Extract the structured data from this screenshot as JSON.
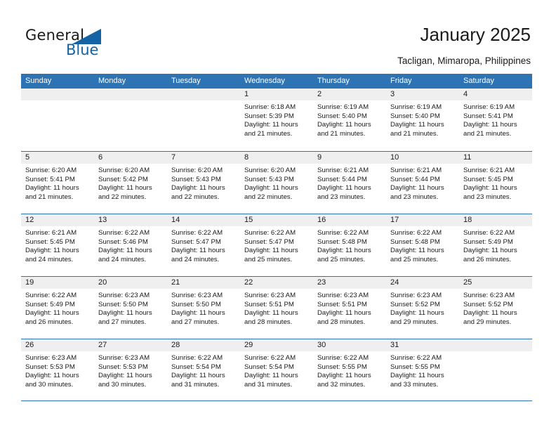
{
  "brand": {
    "name_part1": "General",
    "name_part2": "Blue",
    "accent_color": "#1464a5"
  },
  "header": {
    "title": "January 2025",
    "subtitle": "Tacligan, Mimaropa, Philippines",
    "header_bg_color": "#2e74b5",
    "daynum_bg_color": "#efefef"
  },
  "weekdays": [
    "Sunday",
    "Monday",
    "Tuesday",
    "Wednesday",
    "Thursday",
    "Friday",
    "Saturday"
  ],
  "weeks": [
    [
      {
        "day": "",
        "sunrise": "",
        "sunset": "",
        "daylight1": "",
        "daylight2": ""
      },
      {
        "day": "",
        "sunrise": "",
        "sunset": "",
        "daylight1": "",
        "daylight2": ""
      },
      {
        "day": "",
        "sunrise": "",
        "sunset": "",
        "daylight1": "",
        "daylight2": ""
      },
      {
        "day": "1",
        "sunrise": "Sunrise: 6:18 AM",
        "sunset": "Sunset: 5:39 PM",
        "daylight1": "Daylight: 11 hours",
        "daylight2": "and 21 minutes."
      },
      {
        "day": "2",
        "sunrise": "Sunrise: 6:19 AM",
        "sunset": "Sunset: 5:40 PM",
        "daylight1": "Daylight: 11 hours",
        "daylight2": "and 21 minutes."
      },
      {
        "day": "3",
        "sunrise": "Sunrise: 6:19 AM",
        "sunset": "Sunset: 5:40 PM",
        "daylight1": "Daylight: 11 hours",
        "daylight2": "and 21 minutes."
      },
      {
        "day": "4",
        "sunrise": "Sunrise: 6:19 AM",
        "sunset": "Sunset: 5:41 PM",
        "daylight1": "Daylight: 11 hours",
        "daylight2": "and 21 minutes."
      }
    ],
    [
      {
        "day": "5",
        "sunrise": "Sunrise: 6:20 AM",
        "sunset": "Sunset: 5:41 PM",
        "daylight1": "Daylight: 11 hours",
        "daylight2": "and 21 minutes."
      },
      {
        "day": "6",
        "sunrise": "Sunrise: 6:20 AM",
        "sunset": "Sunset: 5:42 PM",
        "daylight1": "Daylight: 11 hours",
        "daylight2": "and 22 minutes."
      },
      {
        "day": "7",
        "sunrise": "Sunrise: 6:20 AM",
        "sunset": "Sunset: 5:43 PM",
        "daylight1": "Daylight: 11 hours",
        "daylight2": "and 22 minutes."
      },
      {
        "day": "8",
        "sunrise": "Sunrise: 6:20 AM",
        "sunset": "Sunset: 5:43 PM",
        "daylight1": "Daylight: 11 hours",
        "daylight2": "and 22 minutes."
      },
      {
        "day": "9",
        "sunrise": "Sunrise: 6:21 AM",
        "sunset": "Sunset: 5:44 PM",
        "daylight1": "Daylight: 11 hours",
        "daylight2": "and 23 minutes."
      },
      {
        "day": "10",
        "sunrise": "Sunrise: 6:21 AM",
        "sunset": "Sunset: 5:44 PM",
        "daylight1": "Daylight: 11 hours",
        "daylight2": "and 23 minutes."
      },
      {
        "day": "11",
        "sunrise": "Sunrise: 6:21 AM",
        "sunset": "Sunset: 5:45 PM",
        "daylight1": "Daylight: 11 hours",
        "daylight2": "and 23 minutes."
      }
    ],
    [
      {
        "day": "12",
        "sunrise": "Sunrise: 6:21 AM",
        "sunset": "Sunset: 5:45 PM",
        "daylight1": "Daylight: 11 hours",
        "daylight2": "and 24 minutes."
      },
      {
        "day": "13",
        "sunrise": "Sunrise: 6:22 AM",
        "sunset": "Sunset: 5:46 PM",
        "daylight1": "Daylight: 11 hours",
        "daylight2": "and 24 minutes."
      },
      {
        "day": "14",
        "sunrise": "Sunrise: 6:22 AM",
        "sunset": "Sunset: 5:47 PM",
        "daylight1": "Daylight: 11 hours",
        "daylight2": "and 24 minutes."
      },
      {
        "day": "15",
        "sunrise": "Sunrise: 6:22 AM",
        "sunset": "Sunset: 5:47 PM",
        "daylight1": "Daylight: 11 hours",
        "daylight2": "and 25 minutes."
      },
      {
        "day": "16",
        "sunrise": "Sunrise: 6:22 AM",
        "sunset": "Sunset: 5:48 PM",
        "daylight1": "Daylight: 11 hours",
        "daylight2": "and 25 minutes."
      },
      {
        "day": "17",
        "sunrise": "Sunrise: 6:22 AM",
        "sunset": "Sunset: 5:48 PM",
        "daylight1": "Daylight: 11 hours",
        "daylight2": "and 25 minutes."
      },
      {
        "day": "18",
        "sunrise": "Sunrise: 6:22 AM",
        "sunset": "Sunset: 5:49 PM",
        "daylight1": "Daylight: 11 hours",
        "daylight2": "and 26 minutes."
      }
    ],
    [
      {
        "day": "19",
        "sunrise": "Sunrise: 6:22 AM",
        "sunset": "Sunset: 5:49 PM",
        "daylight1": "Daylight: 11 hours",
        "daylight2": "and 26 minutes."
      },
      {
        "day": "20",
        "sunrise": "Sunrise: 6:23 AM",
        "sunset": "Sunset: 5:50 PM",
        "daylight1": "Daylight: 11 hours",
        "daylight2": "and 27 minutes."
      },
      {
        "day": "21",
        "sunrise": "Sunrise: 6:23 AM",
        "sunset": "Sunset: 5:50 PM",
        "daylight1": "Daylight: 11 hours",
        "daylight2": "and 27 minutes."
      },
      {
        "day": "22",
        "sunrise": "Sunrise: 6:23 AM",
        "sunset": "Sunset: 5:51 PM",
        "daylight1": "Daylight: 11 hours",
        "daylight2": "and 28 minutes."
      },
      {
        "day": "23",
        "sunrise": "Sunrise: 6:23 AM",
        "sunset": "Sunset: 5:51 PM",
        "daylight1": "Daylight: 11 hours",
        "daylight2": "and 28 minutes."
      },
      {
        "day": "24",
        "sunrise": "Sunrise: 6:23 AM",
        "sunset": "Sunset: 5:52 PM",
        "daylight1": "Daylight: 11 hours",
        "daylight2": "and 29 minutes."
      },
      {
        "day": "25",
        "sunrise": "Sunrise: 6:23 AM",
        "sunset": "Sunset: 5:52 PM",
        "daylight1": "Daylight: 11 hours",
        "daylight2": "and 29 minutes."
      }
    ],
    [
      {
        "day": "26",
        "sunrise": "Sunrise: 6:23 AM",
        "sunset": "Sunset: 5:53 PM",
        "daylight1": "Daylight: 11 hours",
        "daylight2": "and 30 minutes."
      },
      {
        "day": "27",
        "sunrise": "Sunrise: 6:23 AM",
        "sunset": "Sunset: 5:53 PM",
        "daylight1": "Daylight: 11 hours",
        "daylight2": "and 30 minutes."
      },
      {
        "day": "28",
        "sunrise": "Sunrise: 6:22 AM",
        "sunset": "Sunset: 5:54 PM",
        "daylight1": "Daylight: 11 hours",
        "daylight2": "and 31 minutes."
      },
      {
        "day": "29",
        "sunrise": "Sunrise: 6:22 AM",
        "sunset": "Sunset: 5:54 PM",
        "daylight1": "Daylight: 11 hours",
        "daylight2": "and 31 minutes."
      },
      {
        "day": "30",
        "sunrise": "Sunrise: 6:22 AM",
        "sunset": "Sunset: 5:55 PM",
        "daylight1": "Daylight: 11 hours",
        "daylight2": "and 32 minutes."
      },
      {
        "day": "31",
        "sunrise": "Sunrise: 6:22 AM",
        "sunset": "Sunset: 5:55 PM",
        "daylight1": "Daylight: 11 hours",
        "daylight2": "and 33 minutes."
      },
      {
        "day": "",
        "sunrise": "",
        "sunset": "",
        "daylight1": "",
        "daylight2": ""
      }
    ]
  ]
}
